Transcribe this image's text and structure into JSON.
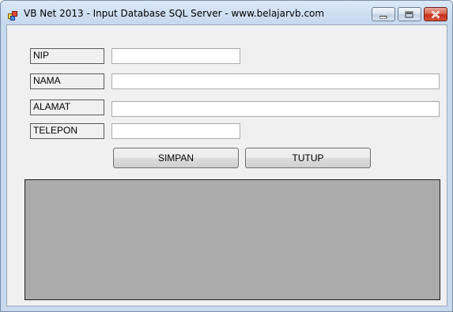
{
  "window": {
    "title": "VB Net 2013 - Input Database SQL Server - www.belajarvb.com",
    "icon": "app-window-icon",
    "caption_buttons": [
      "minimize-icon",
      "maximize-icon",
      "close-icon"
    ]
  },
  "form": {
    "fields": [
      {
        "label": "NIP",
        "value": ""
      },
      {
        "label": "NAMA",
        "value": ""
      },
      {
        "label": "ALAMAT",
        "value": ""
      },
      {
        "label": "TELEPON",
        "value": ""
      }
    ],
    "buttons": {
      "save_label": "SIMPAN",
      "close_label": "TUTUP"
    }
  },
  "colors": {
    "client_bg": "#f0f0f0",
    "grid_bg": "#ababab",
    "close_button": "#c4301a"
  }
}
